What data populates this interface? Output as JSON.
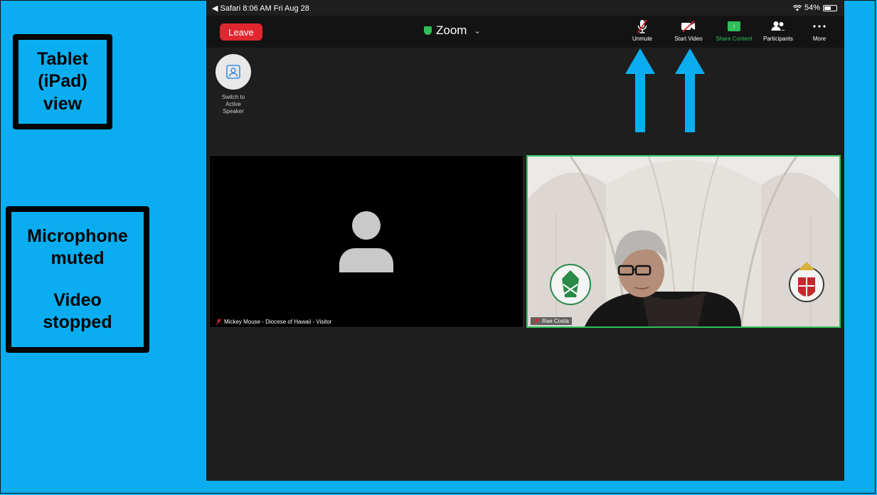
{
  "callouts": {
    "tablet": {
      "lines": [
        "Tablet",
        "(iPad)",
        "view"
      ]
    },
    "status": {
      "line1": "Microphone",
      "line2": "muted",
      "line3": "Video",
      "line4": "stopped"
    }
  },
  "status_bar": {
    "left": "◀ Safari  8:06 AM  Fri Aug 28",
    "battery": "54%"
  },
  "toolbar": {
    "leave": "Leave",
    "meeting_title": "Zoom",
    "buttons": {
      "unmute": "Unmute",
      "start_video": "Start Video",
      "share": "Share Content",
      "participants": "Participants",
      "more": "More"
    }
  },
  "switch_speaker": {
    "line1": "Switch to",
    "line2": "Active Speaker"
  },
  "tiles": [
    {
      "name": "Mickey Mouse - Diocese of Hawaii - Visitor"
    },
    {
      "name": "Rae Costa"
    }
  ],
  "colors": {
    "accent_green": "#2fbf5a",
    "leave_red": "#e0262f",
    "background_blue": "#0aaef0",
    "arrow_blue": "#0aaef0"
  }
}
